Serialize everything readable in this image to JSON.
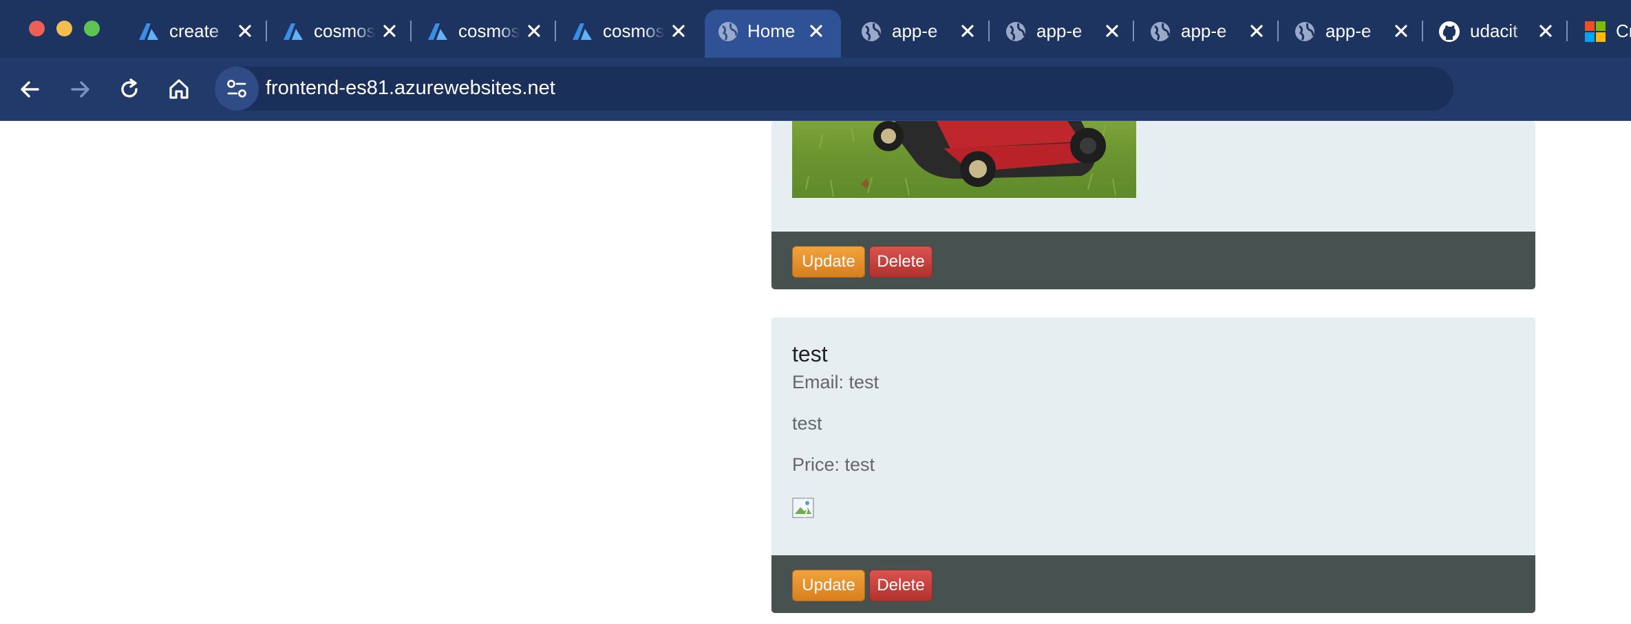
{
  "browser": {
    "tabs": [
      {
        "title": "create",
        "favicon": "azure-icon",
        "active": false
      },
      {
        "title": "cosmos",
        "favicon": "azure-icon",
        "active": false
      },
      {
        "title": "cosmos",
        "favicon": "azure-icon",
        "active": false
      },
      {
        "title": "cosmos",
        "favicon": "azure-icon",
        "active": false
      },
      {
        "title": "Home",
        "favicon": "globe-icon",
        "active": true
      },
      {
        "title": "app-e",
        "favicon": "globe-icon",
        "active": false
      },
      {
        "title": "app-e",
        "favicon": "globe-icon",
        "active": false
      },
      {
        "title": "app-e",
        "favicon": "globe-icon",
        "active": false
      },
      {
        "title": "app-e",
        "favicon": "globe-icon",
        "active": false
      },
      {
        "title": "udacit",
        "favicon": "github-icon",
        "active": false
      },
      {
        "title": "Cr",
        "favicon": "microsoft-icon",
        "active": false
      }
    ],
    "url": "frontend-es81.azurewebsites.net",
    "colors": {
      "tabstrip": "#1d3360",
      "toolbar": "#213a6a",
      "active_tab": "#2f5296"
    }
  },
  "cards": [
    {
      "image": "lawn-mower-photo",
      "update_label": "Update",
      "delete_label": "Delete"
    },
    {
      "title": "test",
      "email": "Email: test",
      "description": "test",
      "price": "Price: test",
      "image": "broken-image-icon",
      "update_label": "Update",
      "delete_label": "Delete"
    }
  ],
  "colors": {
    "card_bg": "#e7eef2",
    "card_footer": "#465150",
    "update_button": "#e8912c",
    "delete_button": "#c9403b"
  }
}
